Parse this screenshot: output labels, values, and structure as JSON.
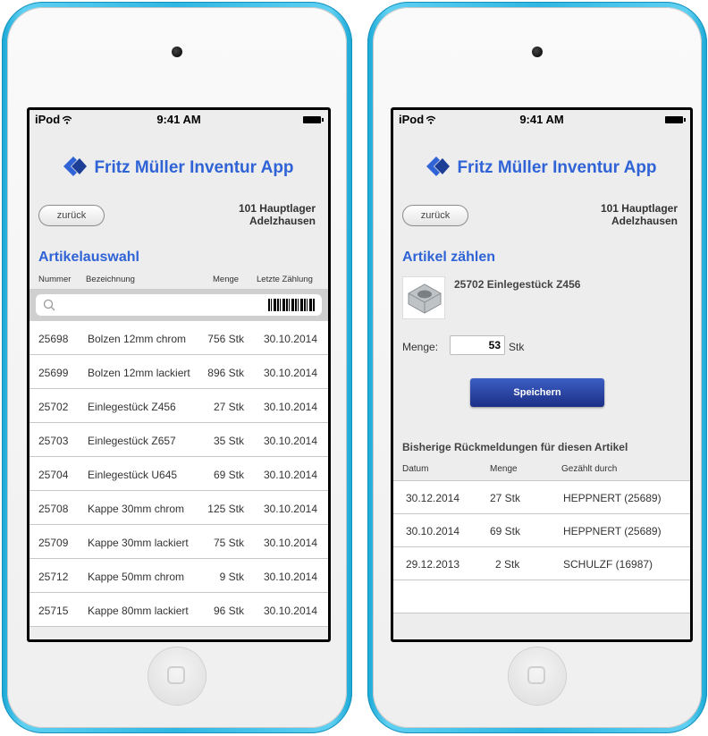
{
  "status": {
    "carrier": "iPod",
    "time": "9:41 AM"
  },
  "app": {
    "title": "Fritz Müller Inventur App"
  },
  "nav": {
    "back_label": "zurück"
  },
  "location": {
    "line1": "101 Hauptlager",
    "line2": "Adelzhausen"
  },
  "left": {
    "section_title": "Artikelauswahl",
    "columns": [
      "Nummer",
      "Bezeichnung",
      "Menge",
      "Letzte Zählung"
    ],
    "search": {
      "value": "",
      "placeholder": ""
    },
    "rows": [
      [
        "25698",
        "Bolzen 12mm chrom",
        "756 Stk",
        "30.10.2014"
      ],
      [
        "25699",
        "Bolzen 12mm lackiert",
        "896 Stk",
        "30.10.2014"
      ],
      [
        "25702",
        "Einlegestück Z456",
        "27 Stk",
        "30.10.2014"
      ],
      [
        "25703",
        "Einlegestück Z657",
        "35 Stk",
        "30.10.2014"
      ],
      [
        "25704",
        "Einlegestück U645",
        "69 Stk",
        "30.10.2014"
      ],
      [
        "25708",
        "Kappe 30mm chrom",
        "125 Stk",
        "30.10.2014"
      ],
      [
        "25709",
        "Kappe 30mm lackiert",
        "75 Stk",
        "30.10.2014"
      ],
      [
        "25712",
        "Kappe 50mm chrom",
        "9 Stk",
        "30.10.2014"
      ],
      [
        "25715",
        "Kappe 80mm lackiert",
        "96 Stk",
        "30.10.2014"
      ]
    ]
  },
  "right": {
    "section_title": "Artikel zählen",
    "article_title": "25702 Einlegestück Z456",
    "qty_label": "Menge:",
    "qty_value": "53",
    "qty_unit": "Stk",
    "save_label": "Speichern",
    "history_title": "Bisherige Rückmeldungen für diesen Artikel",
    "history_columns": [
      "Datum",
      "Menge",
      "Gezählt durch"
    ],
    "history_rows": [
      [
        "30.12.2014",
        "27 Stk",
        "HEPPNERT (25689)"
      ],
      [
        "30.10.2014",
        "69 Stk",
        "HEPPNERT (25689)"
      ],
      [
        "29.12.2013",
        "2 Stk",
        "SCHULZF (16987)"
      ]
    ]
  },
  "colors": {
    "accent": "#2f63d6",
    "device": "#2fb7e3",
    "button": "#1c2f86"
  },
  "icons": [
    "wifi-icon",
    "battery-icon",
    "app-logo-icon",
    "search-icon",
    "barcode-icon"
  ]
}
